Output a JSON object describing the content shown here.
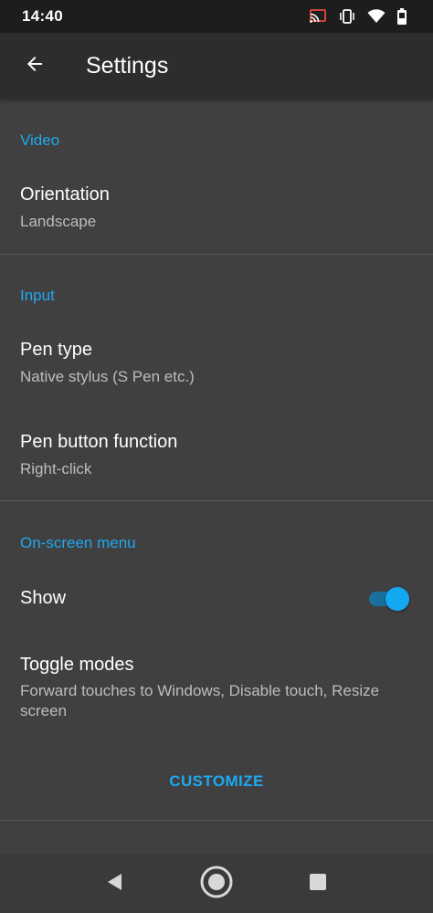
{
  "status_bar": {
    "time": "14:40",
    "icons": [
      "cast-icon",
      "vibrate-icon",
      "wifi-icon",
      "battery-icon"
    ]
  },
  "app_bar": {
    "title": "Settings",
    "back_icon": "arrow-back-icon"
  },
  "sections": {
    "video": {
      "header": "Video",
      "orientation": {
        "title": "Orientation",
        "summary": "Landscape"
      }
    },
    "input": {
      "header": "Input",
      "pen_type": {
        "title": "Pen type",
        "summary": "Native stylus (S Pen etc.)"
      },
      "pen_button": {
        "title": "Pen button function",
        "summary": "Right-click"
      }
    },
    "on_screen_menu": {
      "header": "On-screen menu",
      "show": {
        "title": "Show",
        "enabled": true
      },
      "toggle_modes": {
        "title": "Toggle modes",
        "summary": "Forward touches to Windows, Disable touch, Resize screen"
      },
      "customize_label": "CUSTOMIZE"
    }
  },
  "nav_bar": {
    "icons": [
      "back-triangle-icon",
      "home-circle-icon",
      "recents-square-icon"
    ]
  },
  "colors": {
    "accent": "#1ea8f0",
    "background": "#404040",
    "app_bar": "#2d2d2d",
    "status_bar": "#1d1d1d"
  }
}
